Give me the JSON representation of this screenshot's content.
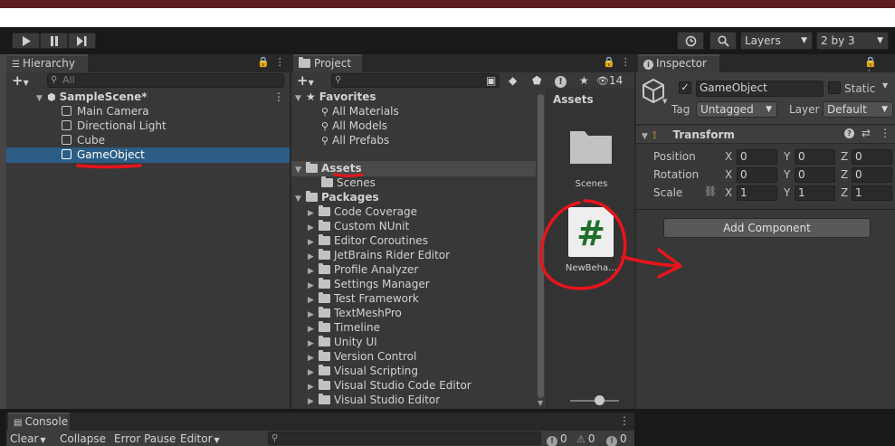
{
  "toolbar": {
    "layers_label": "Layers",
    "layout_label": "2 by 3"
  },
  "hierarchy": {
    "tab": "Hierarchy",
    "search_placeholder": "All",
    "scene": "SampleScene*",
    "items": [
      "Main Camera",
      "Directional Light",
      "Cube",
      "GameObject"
    ]
  },
  "project": {
    "tab": "Project",
    "hidden_count": "14",
    "favorites": {
      "label": "Favorites",
      "items": [
        "All Materials",
        "All Models",
        "All Prefabs"
      ]
    },
    "assets": {
      "label": "Assets",
      "items": [
        "Scenes"
      ]
    },
    "packages": {
      "label": "Packages",
      "items": [
        "Code Coverage",
        "Custom NUnit",
        "Editor Coroutines",
        "JetBrains Rider Editor",
        "Profile Analyzer",
        "Settings Manager",
        "Test Framework",
        "TextMeshPro",
        "Timeline",
        "Unity UI",
        "Version Control",
        "Visual Scripting",
        "Visual Studio Code Editor",
        "Visual Studio Editor"
      ]
    },
    "grid": {
      "header": "Assets",
      "folder_label": "Scenes",
      "script_label": "NewBeha…",
      "script_glyph": "#"
    }
  },
  "inspector": {
    "tab": "Inspector",
    "object_name": "GameObject",
    "static_label": "Static",
    "tag_label": "Tag",
    "tag_value": "Untagged",
    "layer_label": "Layer",
    "layer_value": "Default",
    "transform": {
      "title": "Transform",
      "rows": [
        {
          "label": "Position",
          "x": "0",
          "y": "0",
          "z": "0"
        },
        {
          "label": "Rotation",
          "x": "0",
          "y": "0",
          "z": "0"
        },
        {
          "label": "Scale",
          "x": "1",
          "y": "1",
          "z": "1"
        }
      ],
      "axis_x": "X",
      "axis_y": "Y",
      "axis_z": "Z"
    },
    "add_component": "Add Component"
  },
  "console": {
    "tab": "Console",
    "clear": "Clear",
    "collapse": "Collapse",
    "error_pause": "Error Pause",
    "editor": "Editor",
    "log_count": "0",
    "warn_count": "0",
    "error_count": "0"
  },
  "colors": {
    "selection": "#2c5d87",
    "annotation_red": "#e8141c"
  }
}
